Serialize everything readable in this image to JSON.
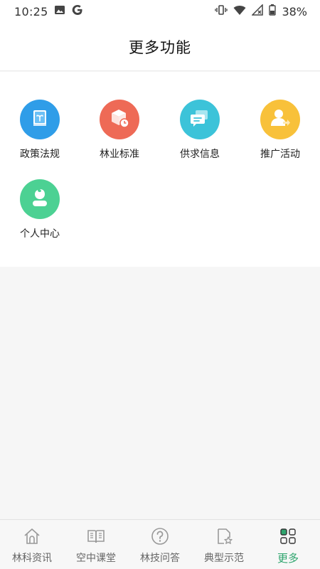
{
  "status_bar": {
    "time": "10:25",
    "battery": "38%",
    "icons": [
      "image-icon",
      "google-icon",
      "vibrate-icon",
      "wifi-icon",
      "signal-icon",
      "battery-icon"
    ]
  },
  "header": {
    "title": "更多功能"
  },
  "features": [
    {
      "label": "政策法规",
      "icon": "policy-book-icon",
      "color": "#2f9de8"
    },
    {
      "label": "林业标准",
      "icon": "standard-box-icon",
      "color": "#ee6a56"
    },
    {
      "label": "供求信息",
      "icon": "message-icon",
      "color": "#3cc3d9"
    },
    {
      "label": "推广活动",
      "icon": "promotion-user-icon",
      "color": "#f8c13a"
    },
    {
      "label": "个人中心",
      "icon": "profile-icon",
      "color": "#4cd193"
    }
  ],
  "tabs": [
    {
      "label": "林科资讯",
      "icon": "home-icon",
      "active": false
    },
    {
      "label": "空中课堂",
      "icon": "book-icon",
      "active": false
    },
    {
      "label": "林技问答",
      "icon": "question-icon",
      "active": false
    },
    {
      "label": "典型示范",
      "icon": "star-doc-icon",
      "active": false
    },
    {
      "label": "更多",
      "icon": "grid-icon",
      "active": true
    }
  ],
  "colors": {
    "accent": "#2fa56e",
    "background": "#f6f6f6"
  }
}
